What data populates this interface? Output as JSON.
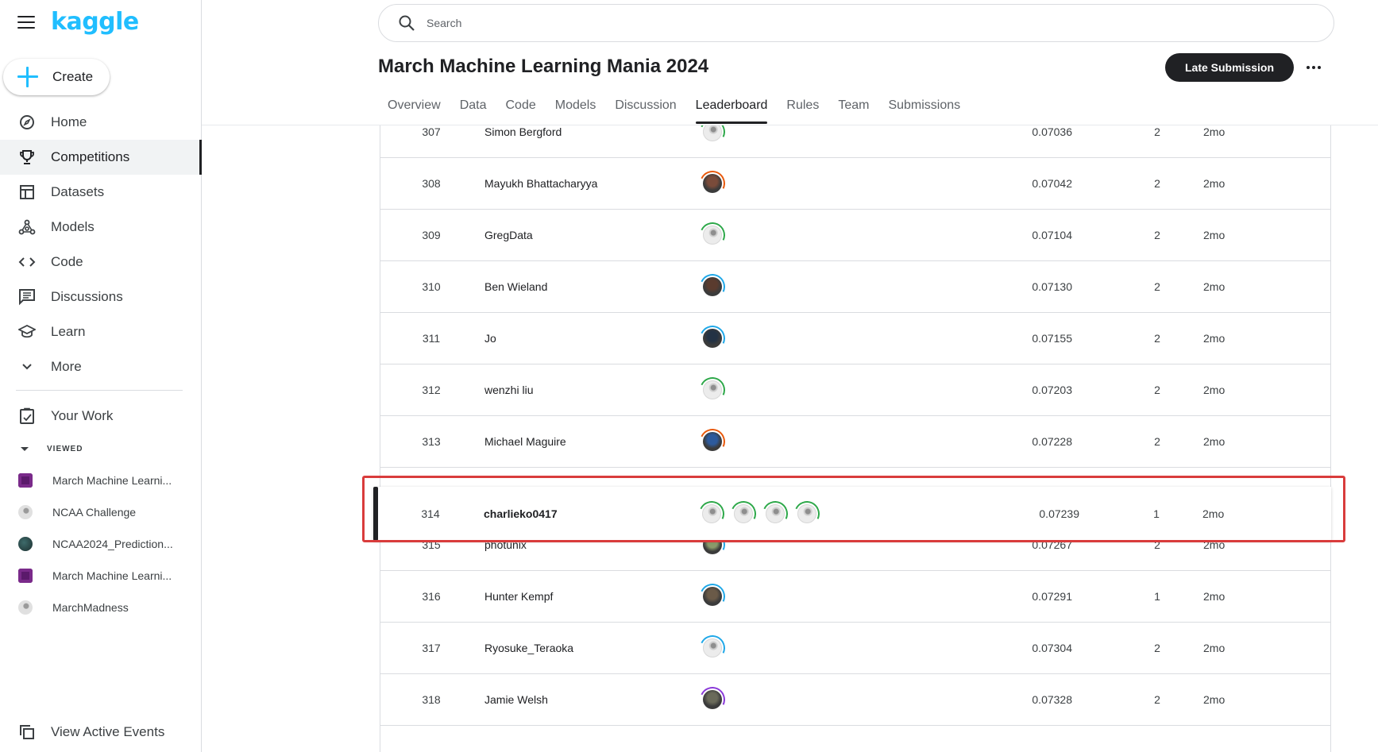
{
  "app": {
    "logo": "kaggle"
  },
  "sidebar": {
    "create_label": "Create",
    "items": [
      {
        "label": "Home",
        "icon": "compass-icon",
        "active": false
      },
      {
        "label": "Competitions",
        "icon": "trophy-icon",
        "active": true
      },
      {
        "label": "Datasets",
        "icon": "table-icon",
        "active": false
      },
      {
        "label": "Models",
        "icon": "models-icon",
        "active": false
      },
      {
        "label": "Code",
        "icon": "code-icon",
        "active": false
      },
      {
        "label": "Discussions",
        "icon": "discussion-icon",
        "active": false
      },
      {
        "label": "Learn",
        "icon": "graduation-cap-icon",
        "active": false
      },
      {
        "label": "More",
        "icon": "chevron-down-icon",
        "active": false
      }
    ],
    "your_work": "Your Work",
    "viewed_label": "VIEWED",
    "recent": [
      {
        "label": "March Machine Learni...",
        "thumb": "competition-thumb",
        "color": "#5b1a6b"
      },
      {
        "label": "NCAA Challenge",
        "thumb": "default-avatar",
        "color": "#c8c8c8"
      },
      {
        "label": "NCAA2024_Prediction...",
        "thumb": "user-avatar",
        "color": "#2f4f4f"
      },
      {
        "label": "March Machine Learni...",
        "thumb": "competition-thumb",
        "color": "#5b1a6b"
      },
      {
        "label": "MarchMadness",
        "thumb": "default-avatar",
        "color": "#c8c8c8"
      }
    ],
    "view_events": "View Active Events"
  },
  "header": {
    "search_placeholder": "Search",
    "title": "March Machine Learning Mania 2024",
    "late_submission": "Late Submission",
    "tabs": [
      {
        "label": "Overview",
        "active": false
      },
      {
        "label": "Data",
        "active": false
      },
      {
        "label": "Code",
        "active": false
      },
      {
        "label": "Models",
        "active": false
      },
      {
        "label": "Discussion",
        "active": false
      },
      {
        "label": "Leaderboard",
        "active": true
      },
      {
        "label": "Rules",
        "active": false
      },
      {
        "label": "Team",
        "active": false
      },
      {
        "label": "Submissions",
        "active": false
      }
    ]
  },
  "leaderboard": {
    "rows": [
      {
        "rank": "307",
        "name": "Simon Bergford",
        "score": "0.07036",
        "entries": "2",
        "last": "2mo",
        "avatars": [
          {
            "type": "default",
            "ring": "#2ea84a"
          }
        ]
      },
      {
        "rank": "308",
        "name": "Mayukh Bhattacharyya",
        "score": "0.07042",
        "entries": "2",
        "last": "2mo",
        "avatars": [
          {
            "type": "photo",
            "ring": "#e8590c",
            "face": "#7a4b3a"
          }
        ]
      },
      {
        "rank": "309",
        "name": "GregData",
        "score": "0.07104",
        "entries": "2",
        "last": "2mo",
        "avatars": [
          {
            "type": "default",
            "ring": "#2ea84a"
          }
        ]
      },
      {
        "rank": "310",
        "name": "Ben Wieland",
        "score": "0.07130",
        "entries": "2",
        "last": "2mo",
        "avatars": [
          {
            "type": "photo",
            "ring": "#20a8e8",
            "face": "#5a3b2e"
          }
        ]
      },
      {
        "rank": "311",
        "name": "Jo",
        "score": "0.07155",
        "entries": "2",
        "last": "2mo",
        "avatars": [
          {
            "type": "photo",
            "ring": "#20a8e8",
            "face": "#233244"
          }
        ]
      },
      {
        "rank": "312",
        "name": "wenzhi liu",
        "score": "0.07203",
        "entries": "2",
        "last": "2mo",
        "avatars": [
          {
            "type": "default",
            "ring": "#2ea84a"
          }
        ]
      },
      {
        "rank": "313",
        "name": "Michael Maguire",
        "score": "0.07228",
        "entries": "2",
        "last": "2mo",
        "avatars": [
          {
            "type": "photo",
            "ring": "#e8590c",
            "face": "#2d5a9c"
          }
        ]
      },
      {
        "rank": "315",
        "name": "photunix",
        "score": "0.07267",
        "entries": "2",
        "last": "2mo",
        "avatars": [
          {
            "type": "photo",
            "ring": "#20a8e8",
            "face": "#8a9a6a"
          }
        ]
      },
      {
        "rank": "316",
        "name": "Hunter Kempf",
        "score": "0.07291",
        "entries": "1",
        "last": "2mo",
        "avatars": [
          {
            "type": "photo",
            "ring": "#20a8e8",
            "face": "#6a5a48"
          }
        ]
      },
      {
        "rank": "317",
        "name": "Ryosuke_Teraoka",
        "score": "0.07304",
        "entries": "2",
        "last": "2mo",
        "avatars": [
          {
            "type": "default",
            "ring": "#20a8e8"
          }
        ]
      },
      {
        "rank": "318",
        "name": "Jamie Welsh",
        "score": "0.07328",
        "entries": "2",
        "last": "2mo",
        "avatars": [
          {
            "type": "photo",
            "ring": "#8a3ad8",
            "face": "#6a6a5a"
          }
        ]
      }
    ],
    "my_row": {
      "rank": "314",
      "name": "charlieko0417",
      "score": "0.07239",
      "entries": "1",
      "last": "2mo",
      "avatars": [
        {
          "type": "default",
          "ring": "#2ea84a"
        },
        {
          "type": "default",
          "ring": "#2ea84a"
        },
        {
          "type": "default",
          "ring": "#2ea84a"
        },
        {
          "type": "default",
          "ring": "#2ea84a"
        }
      ]
    }
  }
}
